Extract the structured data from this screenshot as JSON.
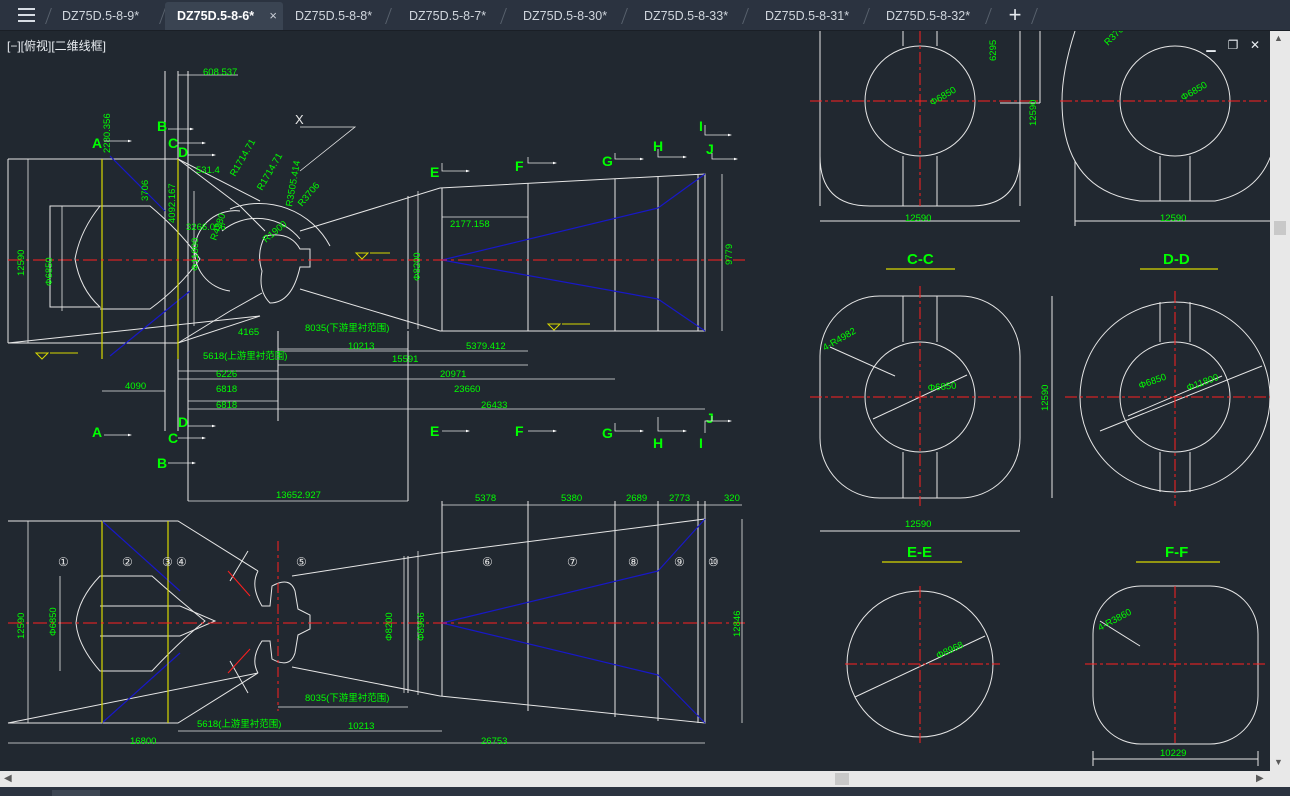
{
  "tabs": [
    {
      "label": "DZ75D.5-8-9*",
      "active": false
    },
    {
      "label": "DZ75D.5-8-6*",
      "active": true
    },
    {
      "label": "DZ75D.5-8-8*",
      "active": false
    },
    {
      "label": "DZ75D.5-8-7*",
      "active": false
    },
    {
      "label": "DZ75D.5-8-30*",
      "active": false
    },
    {
      "label": "DZ75D.5-8-33*",
      "active": false
    },
    {
      "label": "DZ75D.5-8-31*",
      "active": false
    },
    {
      "label": "DZ75D.5-8-32*",
      "active": false
    }
  ],
  "tab_close_glyph": "×",
  "add_tab_glyph": "+",
  "viewport": {
    "label": "[−][俯视][二维线框]"
  },
  "window_controls": {
    "minimize": "▁",
    "restore": "❐",
    "close": "✕"
  },
  "colors": {
    "background": "#212830",
    "lines": "#e6e6e6",
    "dimensions": "#00ff00",
    "centerlines": "#ff1f1f",
    "blue": "#1818c8",
    "yellow": "#d8d800"
  },
  "drawing": {
    "plan_dims": [
      "608.537",
      "2280.356",
      "3706",
      "R1714.71",
      "R1714.71",
      "R3505.414",
      "R3706",
      "4092.167",
      "Φ11800",
      "Φ6850",
      "12590",
      "3266.056",
      "2177.158",
      "Φ8200",
      "9779",
      "4165",
      "8035(下游里衬范围)",
      "5618(上游里衬范围)",
      "10213",
      "5379.412",
      "15591",
      "6226",
      "20971",
      "6818",
      "23660",
      "6818",
      "26433",
      "4090",
      "13652.927",
      "531.4",
      "R4380",
      "R1900"
    ],
    "section_letters_top": [
      "A",
      "B",
      "C",
      "D",
      "E",
      "F",
      "G",
      "H",
      "I",
      "J"
    ],
    "section_letters_bottom": [
      "A",
      "B",
      "C",
      "D",
      "E",
      "F",
      "G",
      "H",
      "I",
      "J"
    ],
    "section_x_label": "X",
    "elev_dims": [
      "5378",
      "5380",
      "2689",
      "2773",
      "320",
      "12590",
      "Φ6850",
      "Φ8200",
      "Φ8966",
      "12846",
      "8035(下游里衬范围)",
      "5618(上游里衬范围)",
      "10213",
      "16800",
      "26753"
    ],
    "elev_markers": [
      "①",
      "②",
      "③",
      "④",
      "⑤",
      "⑥",
      "⑦",
      "⑧",
      "⑨",
      "⑩"
    ],
    "sec_top_dims": [
      "6295",
      "12590",
      "Φ6850",
      "12590",
      "R3706",
      "Φ6850",
      "12590"
    ],
    "section_titles": [
      "C-C",
      "D-D",
      "E-E",
      "F-F"
    ],
    "sec_cc": {
      "r": "4-R4982",
      "d": "Φ6850",
      "w": "12590",
      "h": "12590"
    },
    "sec_dd": {
      "d1": "Φ6850",
      "d2": "Φ11800"
    },
    "sec_ee": {
      "d": "Φ8968"
    },
    "sec_ff": {
      "r": "4-R3860",
      "w": "10229"
    }
  }
}
